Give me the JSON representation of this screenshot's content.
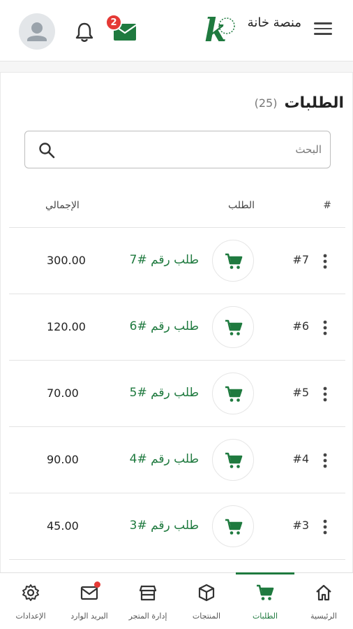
{
  "header": {
    "logo_letter": "k",
    "logo_text": "منصة خانة",
    "mail_badge": "2"
  },
  "orders": {
    "title": "الطلبات",
    "count": "(25)",
    "search_placeholder": "البحث",
    "columns": {
      "hash": "#",
      "order": "الطلب",
      "total": "الإجمالي"
    },
    "rows": [
      {
        "num": "#7",
        "label": "طلب رقم #7",
        "total": "300.00"
      },
      {
        "num": "#6",
        "label": "طلب رقم #6",
        "total": "120.00"
      },
      {
        "num": "#5",
        "label": "طلب رقم #5",
        "total": "70.00"
      },
      {
        "num": "#4",
        "label": "طلب رقم #4",
        "total": "90.00"
      },
      {
        "num": "#3",
        "label": "طلب رقم #3",
        "total": "45.00"
      }
    ]
  },
  "bottom_nav": [
    {
      "label": "الرئيسية",
      "icon": "home-icon"
    },
    {
      "label": "الطلبات",
      "icon": "cart-icon",
      "active": true
    },
    {
      "label": "المنتجات",
      "icon": "box-icon"
    },
    {
      "label": "إدارة المتجر",
      "icon": "store-icon"
    },
    {
      "label": "البريد الوارد",
      "icon": "mail-icon"
    },
    {
      "label": "الإعدادات",
      "icon": "gear-icon"
    }
  ],
  "colors": {
    "accent": "#1f7a3f",
    "badge": "#e53935"
  }
}
